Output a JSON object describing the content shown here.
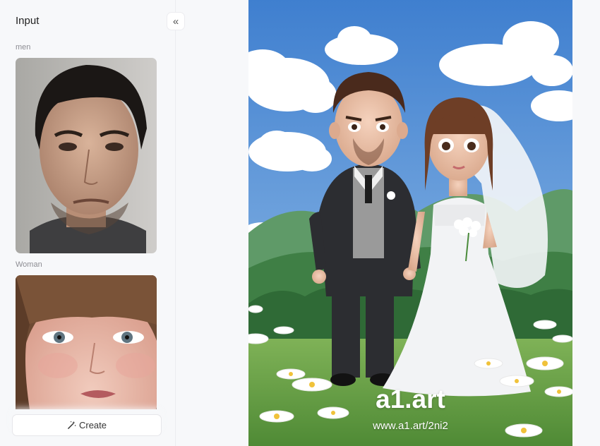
{
  "panel": {
    "title": "Input",
    "collapse_icon": "«",
    "men_label": "men",
    "woman_label": "Woman",
    "create_label": "Create",
    "create_icon": "magic-wand"
  },
  "result": {
    "brand": "a1.art",
    "url": "www.a1.art/2ni2"
  },
  "colors": {
    "panel_bg": "#f7f8fa",
    "sky": "#5b93d6",
    "grass": "#6aa34a"
  }
}
